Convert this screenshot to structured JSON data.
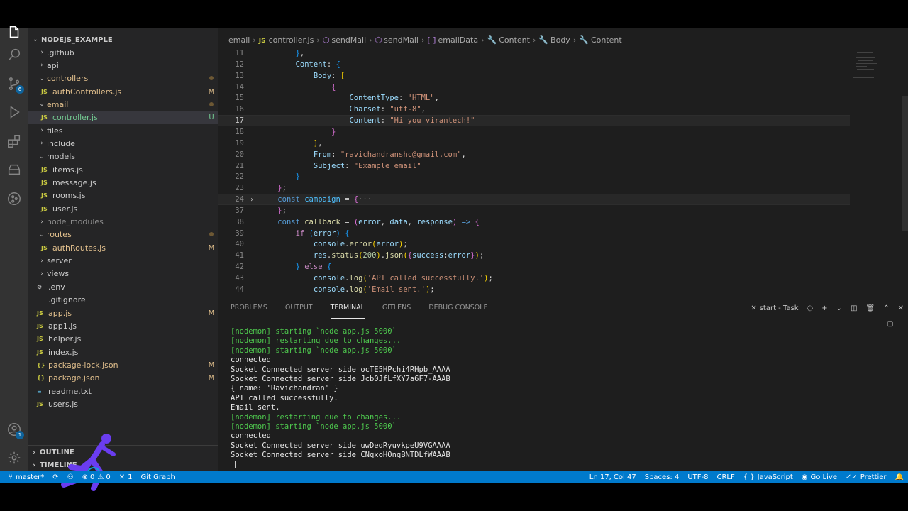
{
  "explorer": {
    "title": "NODEJS_EXAMPLE",
    "items": [
      {
        "name": "github",
        "label": ".github",
        "type": "folder",
        "state": "collapsed",
        "status": ""
      },
      {
        "name": "api",
        "label": "api",
        "type": "folder",
        "state": "collapsed",
        "status": ""
      },
      {
        "name": "controllers",
        "label": "controllers",
        "type": "folder",
        "state": "expanded",
        "status": "dot"
      },
      {
        "name": "authcontrollers",
        "label": "authControllers.js",
        "type": "js",
        "status": "M"
      },
      {
        "name": "email",
        "label": "email",
        "type": "folder",
        "state": "expanded",
        "status": "dot"
      },
      {
        "name": "controller",
        "label": "controller.js",
        "type": "js",
        "status": "U"
      },
      {
        "name": "files",
        "label": "files",
        "type": "folder",
        "state": "collapsed",
        "status": ""
      },
      {
        "name": "include",
        "label": "include",
        "type": "folder",
        "state": "collapsed",
        "status": ""
      },
      {
        "name": "models",
        "label": "models",
        "type": "folder",
        "state": "expanded",
        "status": ""
      },
      {
        "name": "items",
        "label": "items.js",
        "type": "js",
        "status": ""
      },
      {
        "name": "message",
        "label": "message.js",
        "type": "js",
        "status": ""
      },
      {
        "name": "rooms",
        "label": "rooms.js",
        "type": "js",
        "status": ""
      },
      {
        "name": "user",
        "label": "user.js",
        "type": "js",
        "status": ""
      },
      {
        "name": "node-modules",
        "label": "node_modules",
        "type": "folder",
        "state": "collapsed",
        "status": ""
      },
      {
        "name": "routes",
        "label": "routes",
        "type": "folder",
        "state": "expanded",
        "status": "dot"
      },
      {
        "name": "authroutes",
        "label": "authRoutes.js",
        "type": "js",
        "status": "M"
      },
      {
        "name": "server",
        "label": "server",
        "type": "folder",
        "state": "collapsed",
        "status": ""
      },
      {
        "name": "views",
        "label": "views",
        "type": "folder",
        "state": "collapsed",
        "status": ""
      },
      {
        "name": "env",
        "label": ".env",
        "type": "gear",
        "status": ""
      },
      {
        "name": "gitignore",
        "label": ".gitignore",
        "type": "plain",
        "status": ""
      },
      {
        "name": "app",
        "label": "app.js",
        "type": "js",
        "status": "M"
      },
      {
        "name": "app1",
        "label": "app1.js",
        "type": "js",
        "status": ""
      },
      {
        "name": "helper",
        "label": "helper.js",
        "type": "js",
        "status": ""
      },
      {
        "name": "index",
        "label": "index.js",
        "type": "js",
        "status": ""
      },
      {
        "name": "package-lock",
        "label": "package-lock.json",
        "type": "json",
        "status": "M"
      },
      {
        "name": "package",
        "label": "package.json",
        "type": "json",
        "status": "M"
      },
      {
        "name": "readme",
        "label": "readme.txt",
        "type": "txt",
        "status": ""
      },
      {
        "name": "users",
        "label": "users.js",
        "type": "js",
        "status": ""
      }
    ],
    "outline_label": "OUTLINE",
    "timeline_label": "TIMELINE"
  },
  "breadcrumb": [
    "email",
    "controller.js",
    "sendMail",
    "sendMail",
    "emailData",
    "Content",
    "Body",
    "Content"
  ],
  "code_lines": [
    {
      "n": "11",
      "html": "        <span class='t-b3'>}</span>,"
    },
    {
      "n": "12",
      "html": "        <span class='t-prop'>Content</span>: <span class='t-b3'>{</span>"
    },
    {
      "n": "13",
      "html": "            <span class='t-prop'>Body</span>: <span class='t-b1'>[</span>"
    },
    {
      "n": "14",
      "html": "                <span class='t-b2'>{</span>"
    },
    {
      "n": "15",
      "html": "                    <span class='t-prop'>ContentType</span>: <span class='t-str'>\"HTML\"</span>,"
    },
    {
      "n": "16",
      "html": "                    <span class='t-prop'>Charset</span>: <span class='t-str'>\"utf-8\"</span>,"
    },
    {
      "n": "17",
      "html": "                    <span class='t-prop'>Content</span>: <span class='t-str'>\"Hi you virantech!\"</span>",
      "current": true
    },
    {
      "n": "18",
      "html": "                <span class='t-b2'>}</span>"
    },
    {
      "n": "19",
      "html": "            <span class='t-b1'>]</span>,"
    },
    {
      "n": "20",
      "html": "            <span class='t-prop'>From</span>: <span class='t-str'>\"ravichandranshc@gmail.com\"</span>,"
    },
    {
      "n": "21",
      "html": "            <span class='t-prop'>Subject</span>: <span class='t-str'>\"Example email\"</span>"
    },
    {
      "n": "22",
      "html": "        <span class='t-b3'>}</span>"
    },
    {
      "n": "23",
      "html": "    <span class='t-b2'>}</span>;"
    },
    {
      "n": "24",
      "html": "    <span class='t-kw'>const</span> <span class='t-var'>campaign</span> = <span class='t-b2'>{</span><span class='t-dim'>···</span>",
      "fold": true,
      "highlight": true
    },
    {
      "n": "37",
      "html": "    <span class='t-b2'>}</span>;"
    },
    {
      "n": "38",
      "html": "    <span class='t-kw'>const</span> <span class='t-fn'>callback</span> = <span class='t-b2'>(</span><span class='t-prop'>error</span>, <span class='t-prop'>data</span>, <span class='t-prop'>response</span><span class='t-b2'>)</span> <span class='t-kw'>=></span> <span class='t-b2'>{</span>"
    },
    {
      "n": "39",
      "html": "        <span class='t-kw2'>if</span> <span class='t-b3'>(</span><span class='t-prop'>error</span><span class='t-b3'>)</span> <span class='t-b3'>{</span>"
    },
    {
      "n": "40",
      "html": "            <span class='t-prop'>console</span>.<span class='t-fn'>error</span><span class='t-b1'>(</span><span class='t-prop'>error</span><span class='t-b1'>)</span>;"
    },
    {
      "n": "41",
      "html": "            <span class='t-prop'>res</span>.<span class='t-fn'>status</span><span class='t-b1'>(</span><span class='t-num'>200</span><span class='t-b1'>)</span>.<span class='t-fn'>json</span><span class='t-b1'>(</span><span class='t-b2'>{</span><span class='t-prop'>success</span>:<span class='t-prop'>error</span><span class='t-b2'>}</span><span class='t-b1'>)</span>;"
    },
    {
      "n": "42",
      "html": "        <span class='t-b3'>}</span> <span class='t-kw2'>else</span> <span class='t-b3'>{</span>"
    },
    {
      "n": "43",
      "html": "            <span class='t-prop'>console</span>.<span class='t-fn'>log</span><span class='t-b1'>(</span><span class='t-str'>'API called successfully.'</span><span class='t-b1'>)</span>;"
    },
    {
      "n": "44",
      "html": "            <span class='t-prop'>console</span>.<span class='t-fn'>log</span><span class='t-b1'>(</span><span class='t-str'>'Email sent.'</span><span class='t-b1'>)</span>;"
    }
  ],
  "panel": {
    "tabs": [
      "PROBLEMS",
      "OUTPUT",
      "TERMINAL",
      "GITLENS",
      "DEBUG CONSOLE"
    ],
    "active_tab": "TERMINAL",
    "task_label": "start - Task"
  },
  "terminal_lines": [
    {
      "text": "[nodemon] starting `node app.js 5000`",
      "color": "green"
    },
    {
      "text": "[nodemon] restarting due to changes...",
      "color": "green"
    },
    {
      "text": "[nodemon] starting `node app.js 5000`",
      "color": "green"
    },
    {
      "text": "connected",
      "color": "white"
    },
    {
      "text": "Socket Connected server side ocTE5HPchi4RHpb_AAAA",
      "color": "white"
    },
    {
      "text": "Socket Connected server side Jcb0JfLfXY7a6F7-AAAB",
      "color": "white"
    },
    {
      "text": "{ name: 'Ravichandran' }",
      "color": "white"
    },
    {
      "text": "API called successfully.",
      "color": "white"
    },
    {
      "text": "Email sent.",
      "color": "white"
    },
    {
      "text": "[nodemon] restarting due to changes...",
      "color": "green"
    },
    {
      "text": "[nodemon] starting `node app.js 5000`",
      "color": "green"
    },
    {
      "text": "connected",
      "color": "white"
    },
    {
      "text": "Socket Connected server side uwDedRyuvkpeU9VGAAAA",
      "color": "white"
    },
    {
      "text": "Socket Connected server side CNqxoHOnqBNTDLfWAAAB",
      "color": "white"
    }
  ],
  "statusbar": {
    "branch": "master*",
    "errors": "0",
    "warnings": "0",
    "ports": "1",
    "git_graph": "Git Graph",
    "position": "Ln 17, Col 47",
    "spaces": "Spaces: 4",
    "encoding": "UTF-8",
    "eol": "CRLF",
    "language": "JavaScript",
    "golive": "Go Live",
    "prettier": "Prettier"
  },
  "activity": {
    "scm_badge": "6",
    "account_badge": "1"
  },
  "colors": {
    "accent": "#007acc",
    "terminal_green": "#4ec94e",
    "modified": "#e2c08d",
    "untracked": "#73c991"
  }
}
